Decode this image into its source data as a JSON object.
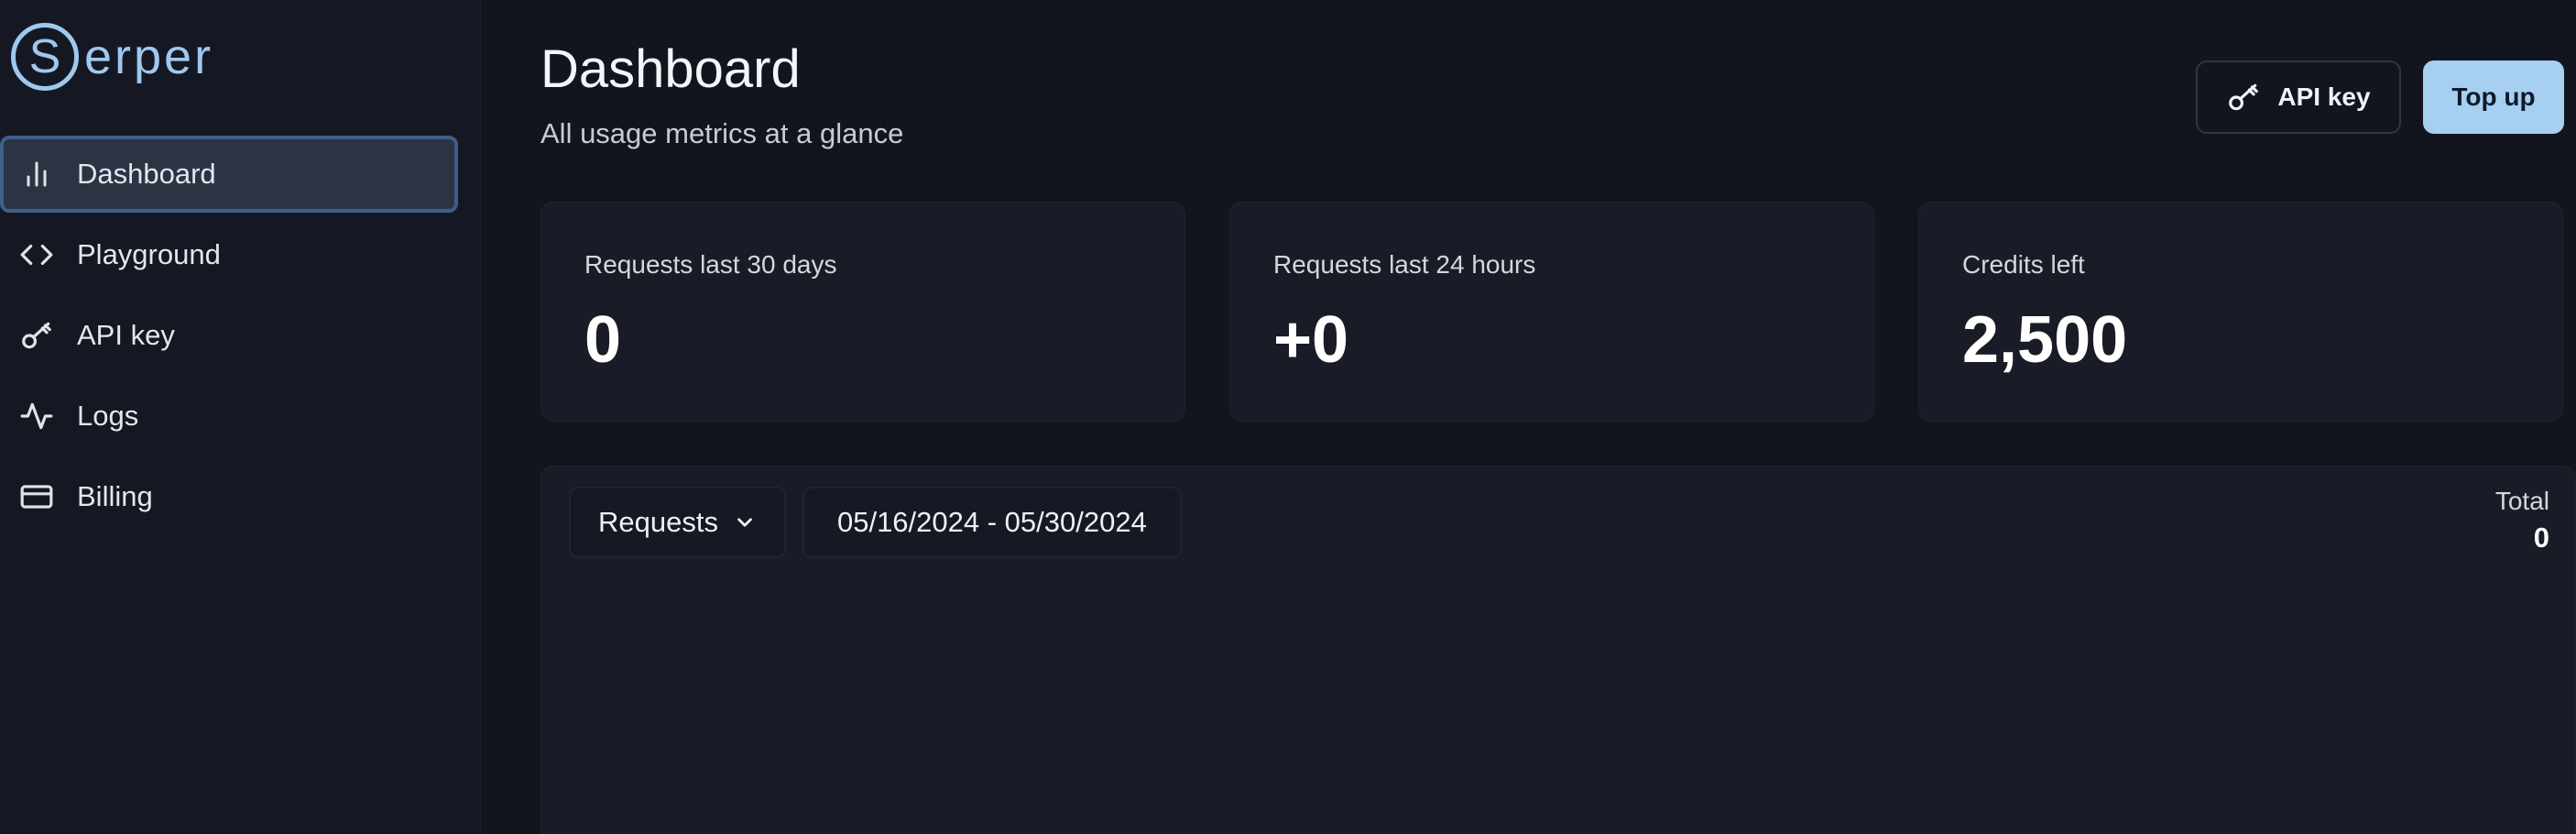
{
  "brand": {
    "mark": "S",
    "text": "erper",
    "color": "#9fc8ee"
  },
  "sidebar": {
    "items": [
      {
        "label": "Dashboard",
        "icon": "bar-chart-icon",
        "active": true
      },
      {
        "label": "Playground",
        "icon": "code-icon",
        "active": false
      },
      {
        "label": "API key",
        "icon": "key-icon",
        "active": false
      },
      {
        "label": "Logs",
        "icon": "activity-icon",
        "active": false
      },
      {
        "label": "Billing",
        "icon": "credit-card-icon",
        "active": false
      }
    ]
  },
  "header": {
    "title": "Dashboard",
    "subtitle": "All usage metrics at a glance",
    "api_key_label": "API key",
    "top_up_label": "Top up"
  },
  "stats": [
    {
      "label": "Requests last 30 days",
      "value": "0"
    },
    {
      "label": "Requests last 24 hours",
      "value": "+0"
    },
    {
      "label": "Credits left",
      "value": "2,500"
    }
  ],
  "chart": {
    "metric_select": "Requests",
    "date_range": "05/16/2024 - 05/30/2024",
    "total_label": "Total",
    "total_value": "0"
  },
  "colors": {
    "background": "#13151e",
    "sidebar": "#151823",
    "card": "#191c27",
    "accent": "#a7cff2",
    "active_border": "#3d5f8c"
  }
}
